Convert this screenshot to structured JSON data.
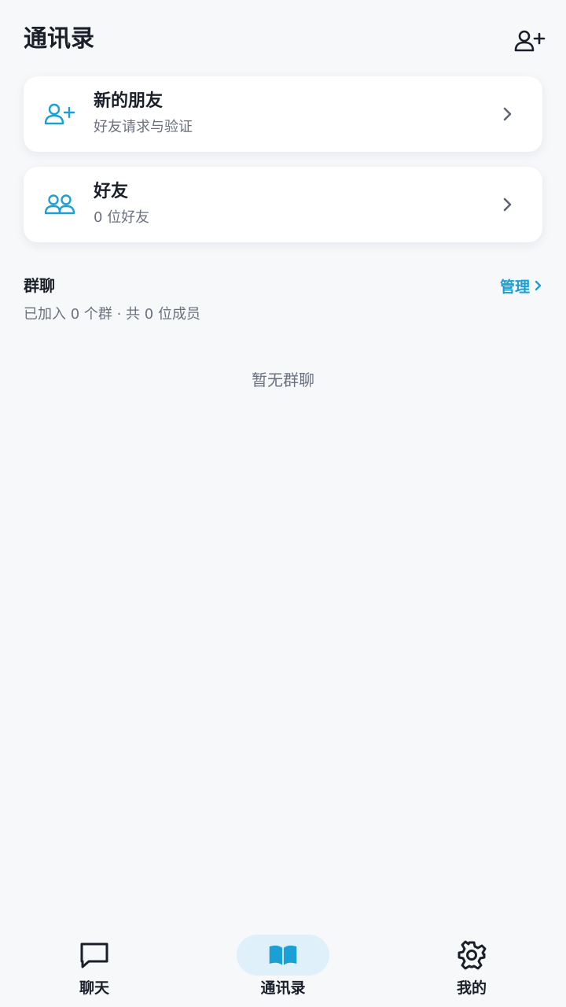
{
  "header": {
    "title": "通讯录",
    "add_icon": "person-add-icon"
  },
  "cards": {
    "new_friends": {
      "title": "新的朋友",
      "subtitle": "好友请求与验证",
      "icon": "person-add-icon"
    },
    "friends": {
      "title": "好友",
      "subtitle": "0 位好友",
      "icon": "people-icon"
    }
  },
  "groups": {
    "title": "群聊",
    "manage_label": "管理",
    "summary": "已加入 0 个群 · 共 0 位成员",
    "empty_text": "暂无群聊"
  },
  "nav": {
    "items": [
      {
        "label": "聊天",
        "icon": "chat-bubble-icon",
        "active": false
      },
      {
        "label": "通讯录",
        "icon": "book-icon",
        "active": true
      },
      {
        "label": "我的",
        "icon": "gear-icon",
        "active": false
      }
    ]
  },
  "colors": {
    "accent": "#1aa0d4",
    "background": "#f7f8fa",
    "text": "#1b1f2a",
    "muted_text": "#6b7180",
    "active_pill": "#dff0fa"
  }
}
